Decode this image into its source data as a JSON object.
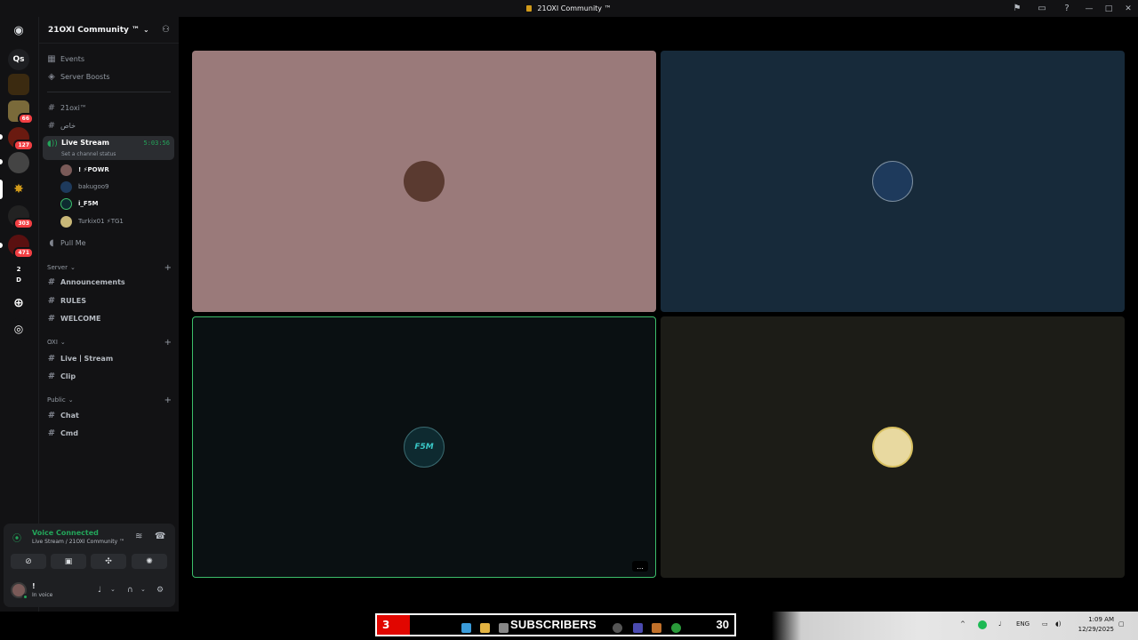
{
  "window": {
    "title": "21OXI Community ™"
  },
  "server": {
    "name": "21OXI Community ™"
  },
  "top_links": [
    {
      "label": "Events"
    },
    {
      "label": "Server Boosts"
    }
  ],
  "guild_badges": {
    "g1": "66",
    "g2": "127",
    "g3": "303",
    "g4": "471",
    "folder_top": "2",
    "folder_bottom": "D"
  },
  "guild_text": {
    "dm": "Qs"
  },
  "channels_top": [
    {
      "label": "21oxi™"
    },
    {
      "label": "خاص"
    }
  ],
  "live_channel": {
    "name": "Live Stream",
    "timer": "5:03:56",
    "status": "Set a channel status"
  },
  "voice_users": [
    {
      "name": "!  ⚡POWR"
    },
    {
      "name": "bakugoo9"
    },
    {
      "name": "i_F5M"
    },
    {
      "name": "Turkix01 ⚡TG1"
    }
  ],
  "pull_me": "Pull Me",
  "categories": [
    {
      "name": "Server",
      "channels": [
        "Announcements",
        "RULES",
        "WELCOME"
      ]
    },
    {
      "name": "OXI",
      "channels": [
        "Live丨Stream",
        "Clip"
      ]
    },
    {
      "name": "Public",
      "channels": [
        "Chat",
        "Cmd"
      ]
    }
  ],
  "voice_panel": {
    "title": "Voice Connected",
    "subtitle": "Live Stream / 21OXI Community ™"
  },
  "user": {
    "name": "!",
    "status": "In voice"
  },
  "tiles": [
    {
      "user": "!  ⚡POWR",
      "bg": "#9a7a7a",
      "avatar": "#5a3a30"
    },
    {
      "user": "bakugoo9",
      "bg": "#172a3a",
      "avatar": "#1e3a5c"
    },
    {
      "user": "i_F5M",
      "bg": "#0a1012",
      "avatar": "#0e2a30",
      "speaking": true,
      "avatar_text": "F5M"
    },
    {
      "user": "Turkix01 ⚡TG1",
      "bg": "#1c1c17",
      "avatar": "#e8d9a0"
    }
  ],
  "tile_menu": "...",
  "overlay": {
    "left_number": "3",
    "label": "SUBSCRIBERS",
    "count": "30"
  },
  "taskbar": {
    "lang": "ENG",
    "time": "1:09 AM",
    "date": "12/29/2025"
  },
  "colors": {
    "accent_green": "#23a55a",
    "badge_red": "#f23f43",
    "sidebar": "#121214"
  }
}
